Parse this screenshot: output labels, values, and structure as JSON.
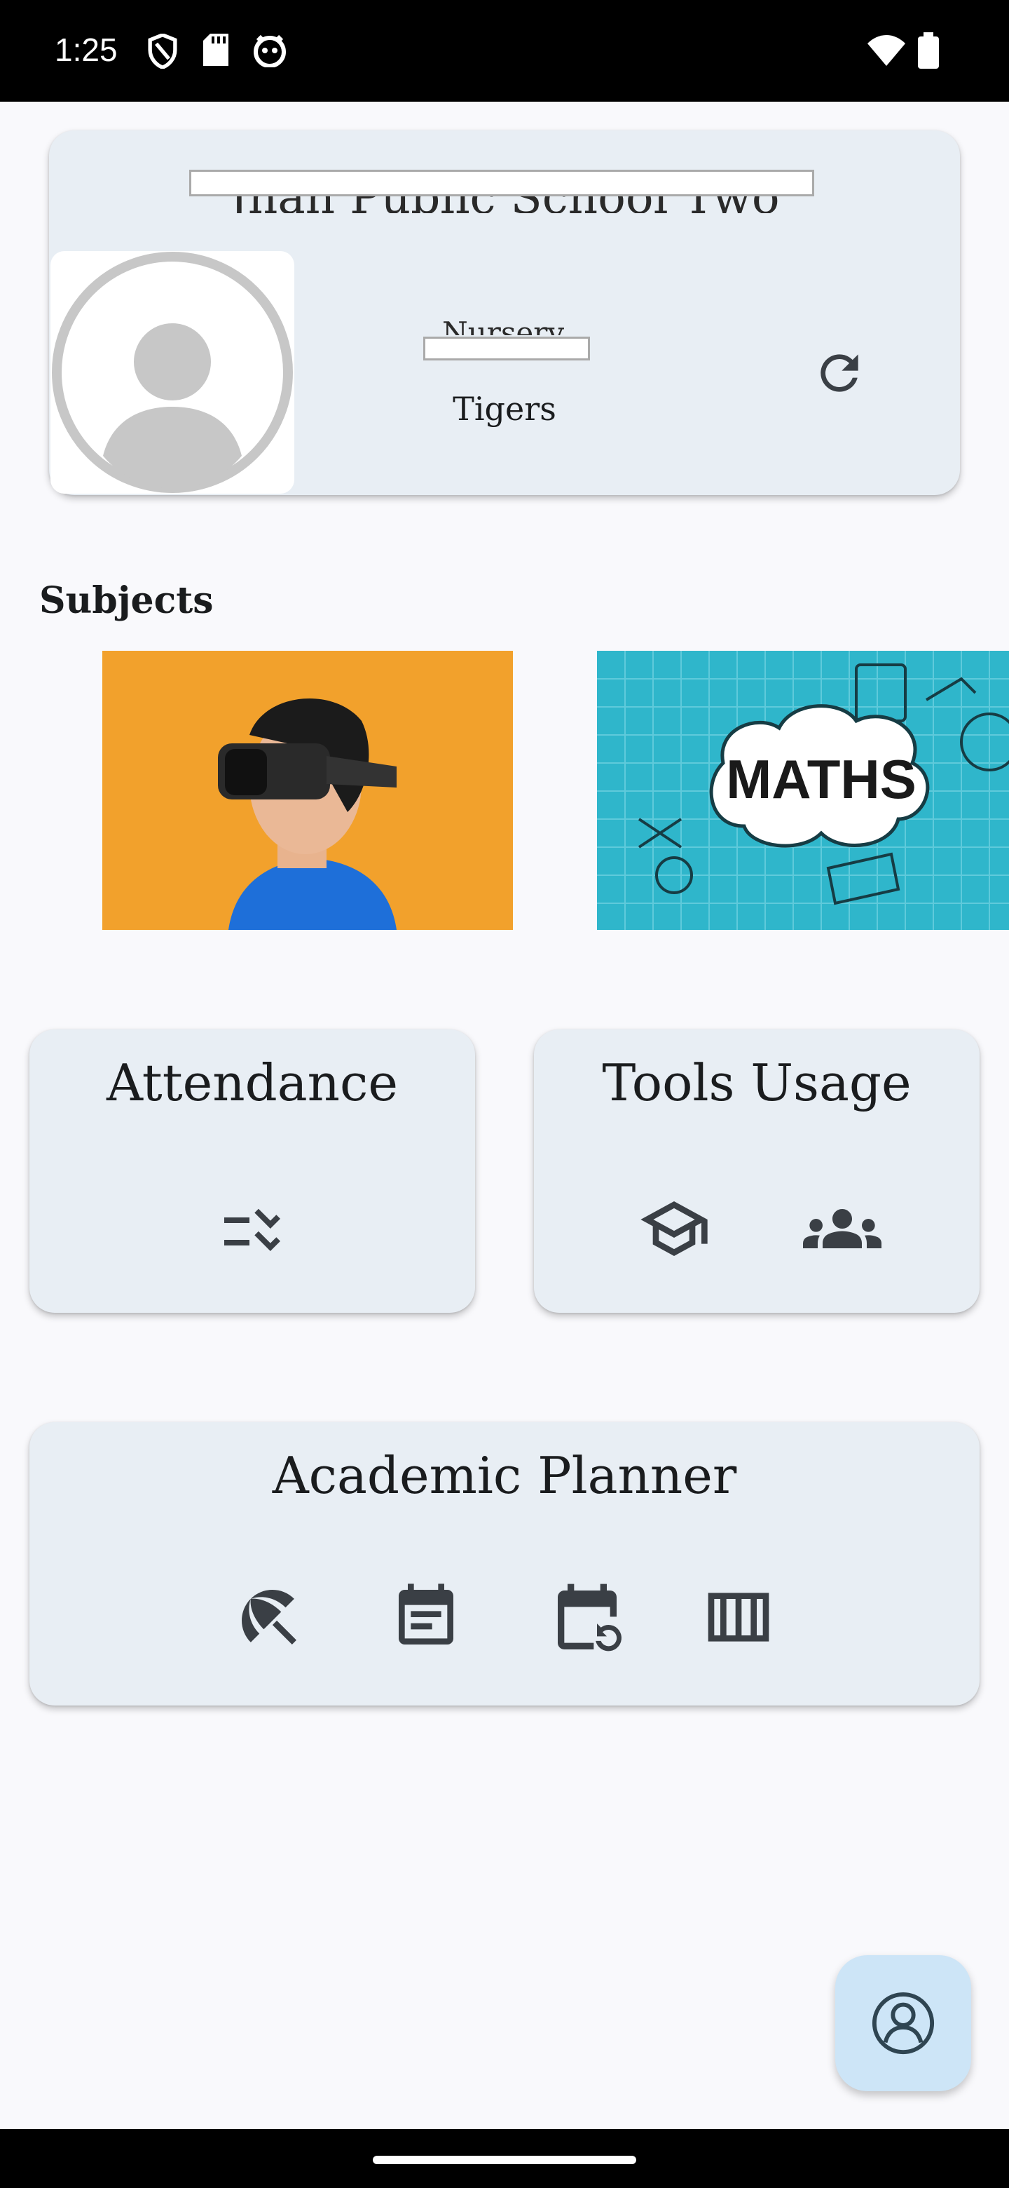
{
  "status_bar": {
    "time": "1:25",
    "icons": [
      "shield-icon",
      "sd-card-icon",
      "notification-app-icon",
      "wifi-icon",
      "battery-icon"
    ]
  },
  "school_card": {
    "school_name": "Jhan Public School Two",
    "class_name": "Nursery",
    "section_name": "Tigers",
    "refresh_icon": "refresh-icon",
    "avatar_icon": "account-circle-icon"
  },
  "subjects": {
    "title": "Subjects",
    "items": [
      {
        "name": "vr-subject",
        "image": "person-with-vr-headset"
      },
      {
        "name": "maths-subject",
        "image_text": "MATHS"
      }
    ]
  },
  "attendance": {
    "title": "Attendance",
    "icons": [
      "checklist-icon"
    ]
  },
  "tools_usage": {
    "title": "Tools Usage",
    "icons": [
      "school-cap-icon",
      "groups-icon"
    ]
  },
  "academic_planner": {
    "title": "Academic Planner",
    "icons": [
      "beach-umbrella-icon",
      "calendar-note-icon",
      "calendar-refresh-icon",
      "timetable-columns-icon"
    ]
  },
  "fab": {
    "icon": "support-person-icon"
  },
  "colors": {
    "background": "#f9f9fc",
    "card": "#e8eef4",
    "fab": "#cde5f7",
    "icon": "#3a3f45",
    "vr_background": "#f0a028",
    "maths_background": "#2fb5c9"
  }
}
